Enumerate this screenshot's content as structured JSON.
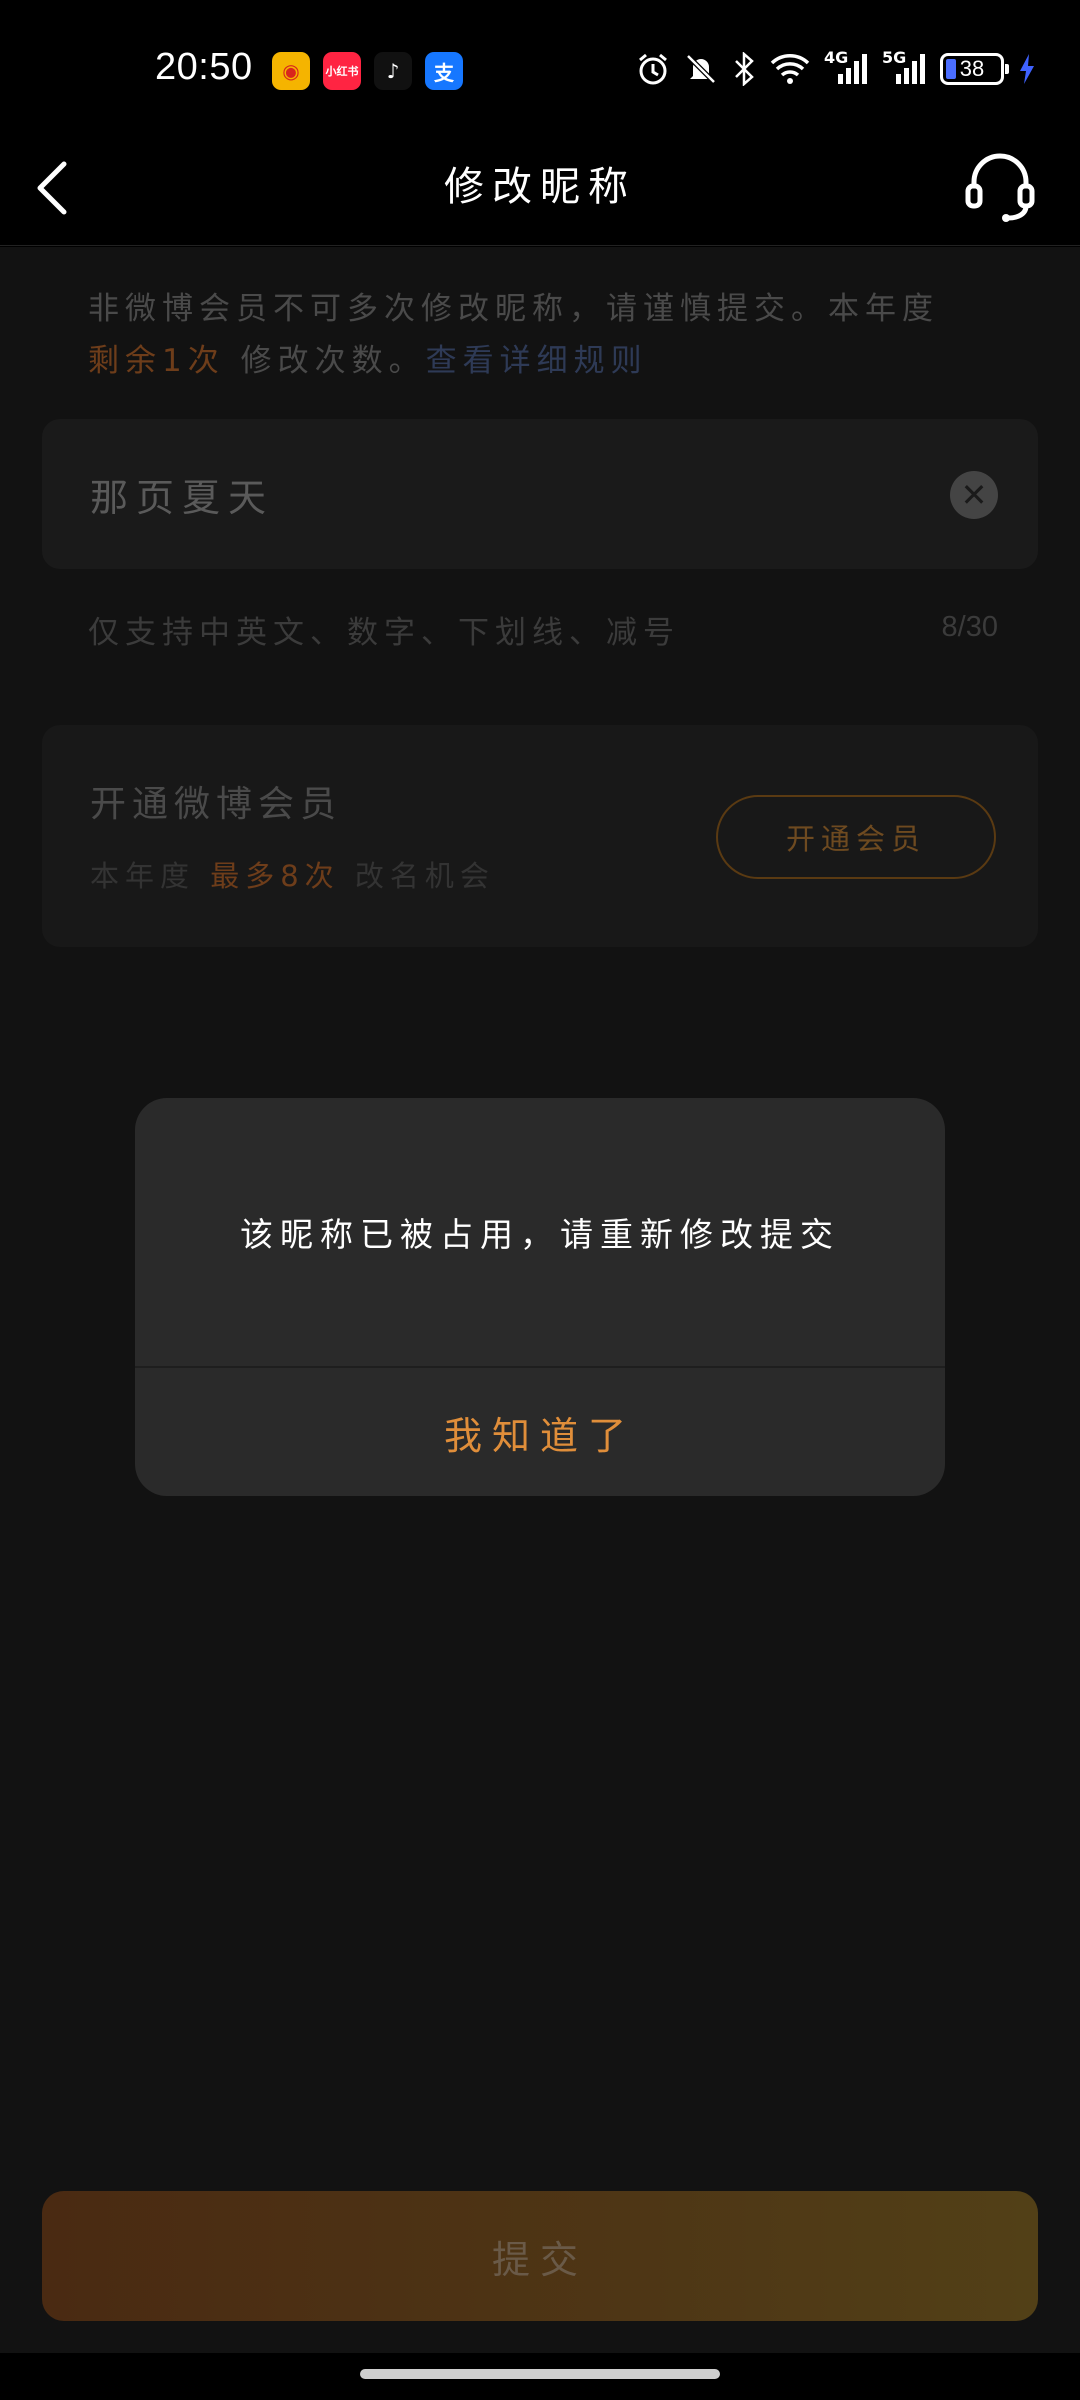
{
  "status_bar": {
    "time": "20:50",
    "apps": [
      {
        "name": "weibo-icon",
        "glyph": "◉",
        "bg": "#f2a900",
        "fg": "#d9261c"
      },
      {
        "name": "xiaohongshu-icon",
        "glyph": "小红书",
        "bg": "#ff2442",
        "fg": "#ffffff"
      },
      {
        "name": "tiktok-icon",
        "glyph": "♪",
        "bg": "#111111",
        "fg": "#ffffff"
      },
      {
        "name": "alipay-icon",
        "glyph": "支",
        "bg": "#1677ff",
        "fg": "#ffffff"
      }
    ],
    "net1": "4G",
    "net2": "5G",
    "battery": "38"
  },
  "header": {
    "title": "修改昵称"
  },
  "notice": {
    "text_before": "非微博会员不可多次修改昵称，请谨慎提交。本年度",
    "remaining": "剩余1次",
    "text_mid": "修改次数。",
    "rules_link": "查看详细规则"
  },
  "nickname_input": {
    "value": "那页夏天",
    "clear_glyph": "✕"
  },
  "hint": {
    "text": "仅支持中英文、数字、下划线、减号",
    "count": "8/30"
  },
  "vip_card": {
    "title": "开通微博会员",
    "sub_before": "本年度",
    "sub_highlight": "最多8次",
    "sub_after": "改名机会",
    "button": "开通会员"
  },
  "submit": {
    "label": "提交"
  },
  "dialog": {
    "message": "该昵称已被占用，请重新修改提交",
    "ok": "我知道了"
  },
  "colors": {
    "accent": "#e08e3a",
    "dialog_bg": "#2a2a2a"
  }
}
